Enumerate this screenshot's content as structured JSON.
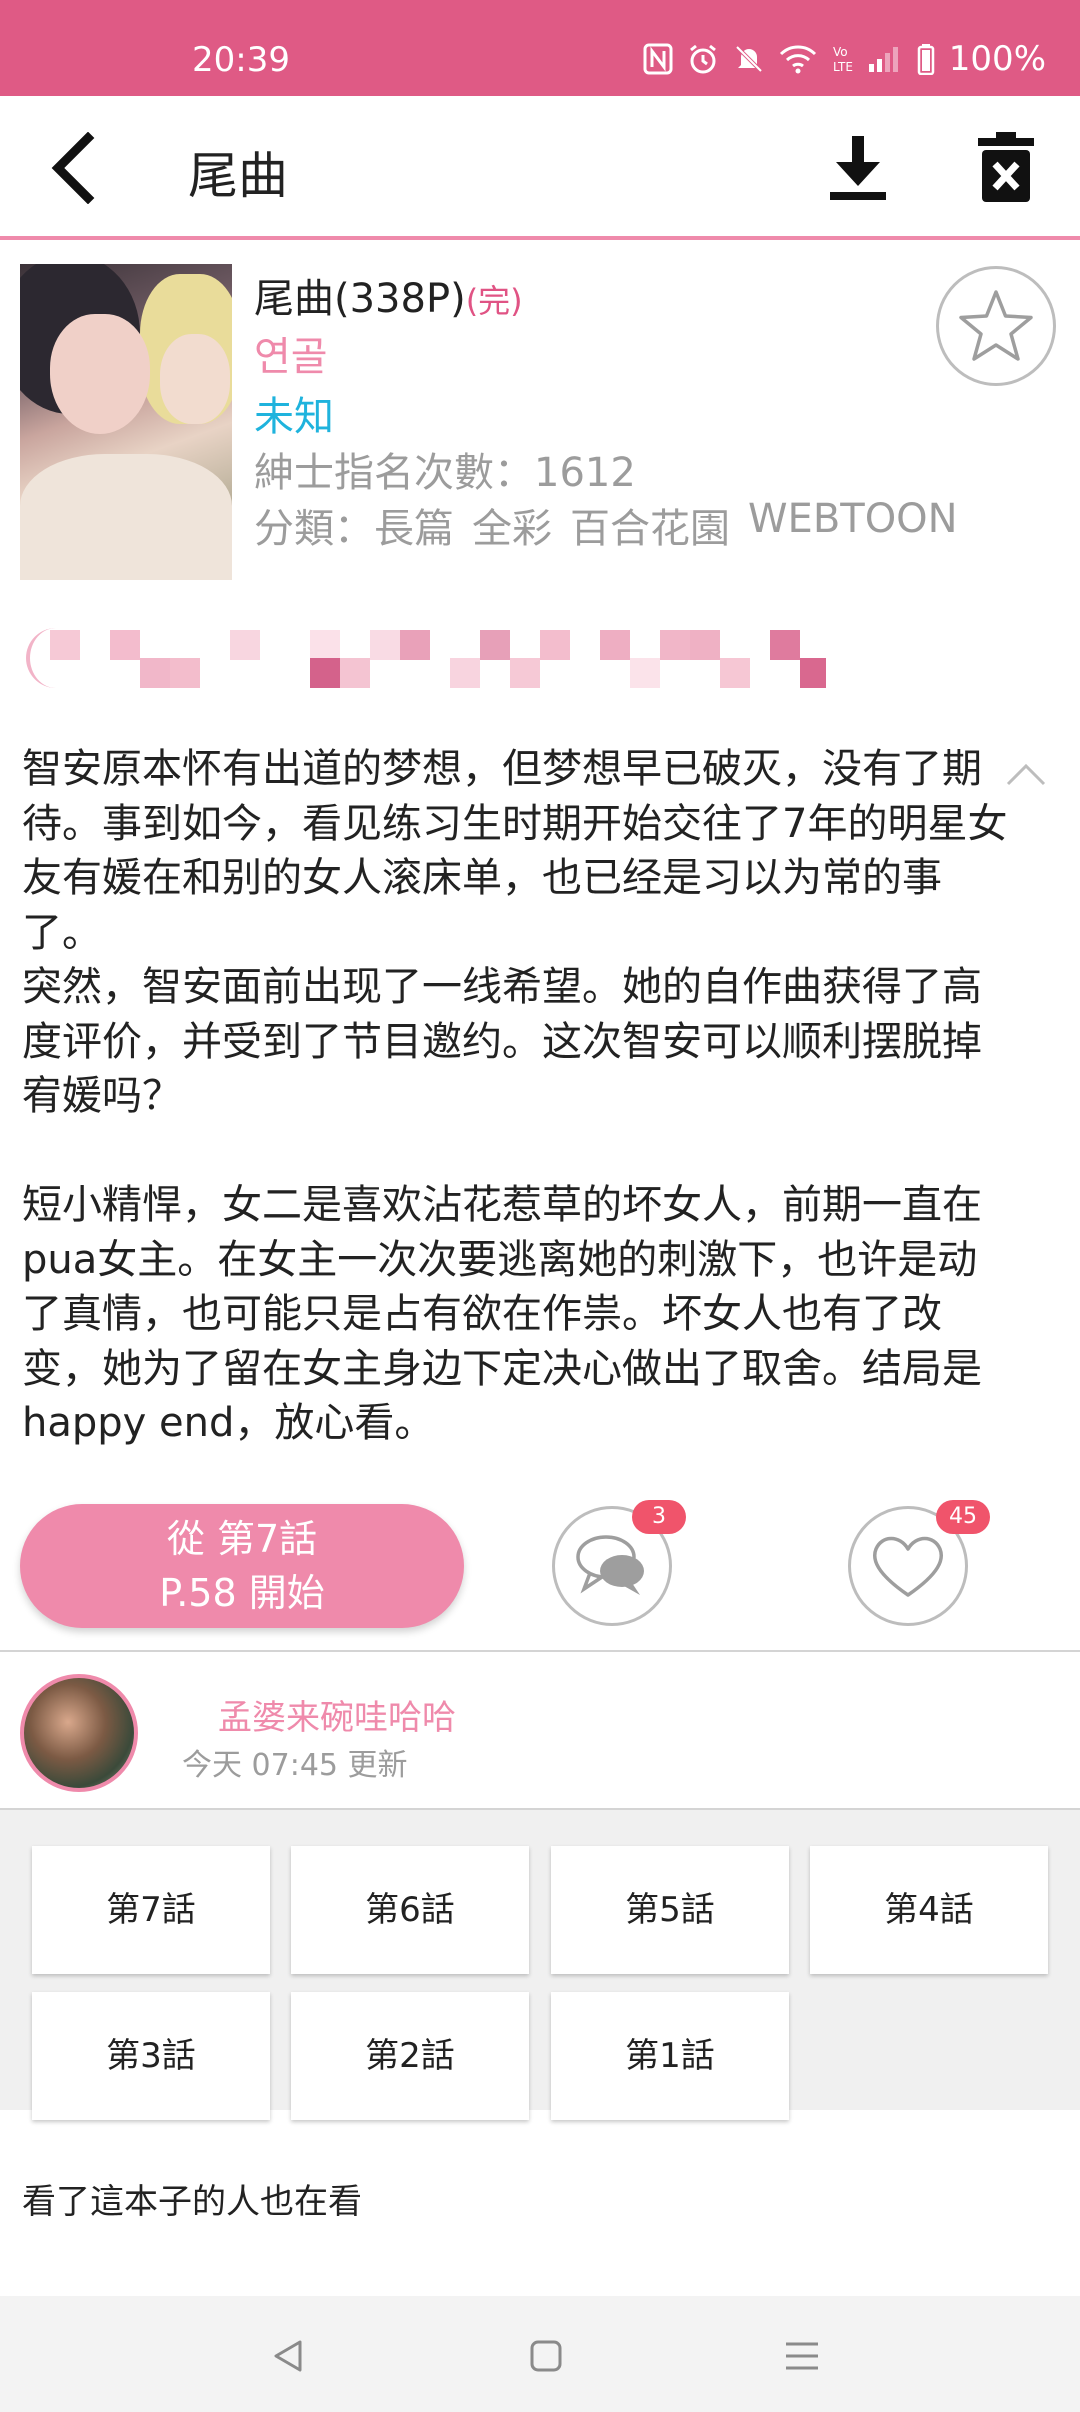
{
  "status_bar": {
    "time": "20:39",
    "battery": "100%",
    "icons": [
      "nfc-icon",
      "alarm-icon",
      "mute-icon",
      "wifi-icon",
      "volte-icon",
      "signal-icon",
      "battery-icon"
    ]
  },
  "app_bar": {
    "title": "尾曲",
    "icons": [
      "back-icon",
      "download-icon",
      "delete-icon"
    ]
  },
  "comic": {
    "title": "尾曲(338P)",
    "status_tag": "(完)",
    "author": "연골",
    "group": "未知",
    "nominations": "紳士指名次數：1612",
    "tags": [
      "分類：",
      "長篇",
      "全彩",
      "百合花園",
      "WEBTOON"
    ],
    "favorite_icon": "star-outline-icon"
  },
  "description": "智安原本怀有出道的梦想，但梦想早已破灭，没有了期待。事到如今，看见练习生时期开始交往了7年的明星女友有媛在和别的女人滚床单，也已经是习以为常的事了。\n突然，智安面前出现了一线希望。她的自作曲获得了高度评价，并受到了节目邀约。这次智安可以顺利摆脱掉宥媛吗？\n\n短小精悍，女二是喜欢沾花惹草的坏女人，前期一直在pua女主。在女主一次次要逃离她的刺激下，也许是动了真情，也可能只是占有欲在作祟。坏女人也有了改变，她为了留在女主身边下定决心做出了取舍。结局是happy end，放心看。",
  "actions": {
    "start_line1": "從 第7話",
    "start_line2": "P.58 開始",
    "comments_count": "3",
    "likes_count": "45"
  },
  "uploader": {
    "name": "孟婆来碗哇哈哈",
    "updated": "今天 07:45 更新"
  },
  "chapters": [
    "第7話",
    "第6話",
    "第5話",
    "第4話",
    "第3話",
    "第2話",
    "第1話"
  ],
  "related_title": "看了這本子的人也在看",
  "nav_bar": [
    "nav-back-icon",
    "nav-home-icon",
    "nav-menu-icon"
  ],
  "colors": {
    "status_bar": "#df5a85",
    "accent_pink": "#ef8aab",
    "group_blue": "#1fb3dd",
    "badge_red": "#f0546b"
  }
}
